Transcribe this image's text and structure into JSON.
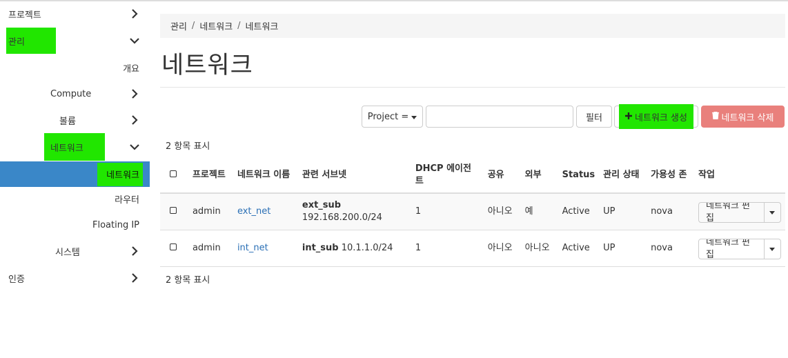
{
  "sidebar": {
    "items": [
      {
        "label": "프로젝트"
      },
      {
        "label": "관리"
      },
      {
        "label": "개요"
      },
      {
        "label": "Compute"
      },
      {
        "label": "볼륨"
      },
      {
        "label": "네트워크"
      },
      {
        "label": "네트워크"
      },
      {
        "label": "라우터"
      },
      {
        "label": "Floating IP"
      },
      {
        "label": "시스템"
      },
      {
        "label": "인증"
      }
    ]
  },
  "breadcrumb": [
    "관리",
    "네트워크",
    "네트워크"
  ],
  "page_title": "네트워크",
  "toolbar": {
    "filter_field": "Project =",
    "filter_value": "",
    "filter_button": "필터",
    "create_button": "네트워크 생성",
    "delete_button": "네트워크 삭제"
  },
  "count_text": "2 항목 표시",
  "table": {
    "headers": [
      "프로젝트",
      "네트워크 이름",
      "관련 서브넷",
      "DHCP 에이전트",
      "공유",
      "외부",
      "Status",
      "관리 상태",
      "가용성 존",
      "작업"
    ],
    "rows": [
      {
        "project": "admin",
        "name": "ext_net",
        "subnet_name": "ext_sub",
        "subnet_cidr": "192.168.200.0/24",
        "dhcp": "1",
        "shared": "아니오",
        "external": "예",
        "status": "Active",
        "admin_state": "UP",
        "zone": "nova",
        "action": "네트워크 편집"
      },
      {
        "project": "admin",
        "name": "int_net",
        "subnet_name": "int_sub",
        "subnet_cidr": "10.1.1.0/24",
        "dhcp": "1",
        "shared": "아니오",
        "external": "아니오",
        "status": "Active",
        "admin_state": "UP",
        "zone": "nova",
        "action": "네트워크 편집"
      }
    ]
  },
  "colors": {
    "highlight": "#21e600",
    "active_nav": "#3a87c8",
    "link": "#2a6fb5",
    "danger": "#e9807c"
  }
}
